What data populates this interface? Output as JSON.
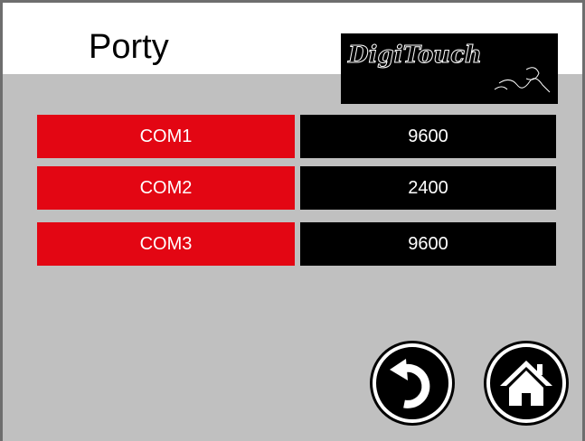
{
  "header": {
    "title": "Porty",
    "logo_text": "DigiTouch"
  },
  "ports": [
    {
      "name": "COM1",
      "baud": "9600"
    },
    {
      "name": "COM2",
      "baud": "2400"
    },
    {
      "name": "COM3",
      "baud": "9600"
    }
  ],
  "buttons": {
    "back_icon": "undo-arrow-icon",
    "home_icon": "home-icon"
  },
  "colors": {
    "port_label_bg": "#e30613",
    "value_bg": "#000000",
    "panel_bg": "#c0c0c0"
  }
}
